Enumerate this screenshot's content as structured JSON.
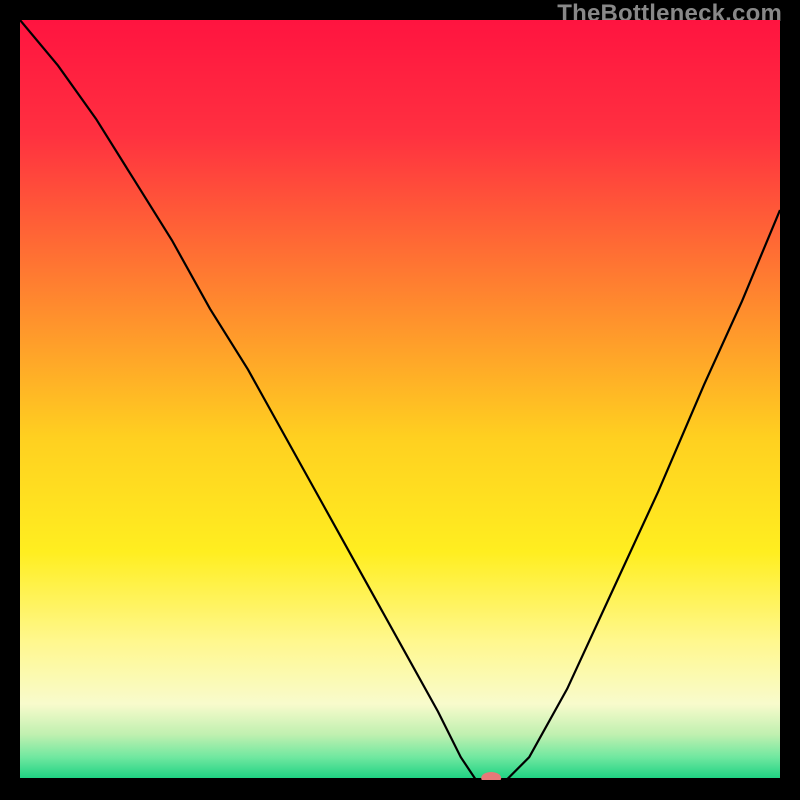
{
  "watermark": "TheBottleneck.com",
  "chart_data": {
    "type": "line",
    "title": "",
    "xlabel": "",
    "ylabel": "",
    "xlim": [
      0,
      100
    ],
    "ylim": [
      0,
      100
    ],
    "background_gradient": {
      "stops": [
        {
          "pos": 0.0,
          "color": "#ff1440"
        },
        {
          "pos": 0.15,
          "color": "#ff3040"
        },
        {
          "pos": 0.35,
          "color": "#ff8030"
        },
        {
          "pos": 0.55,
          "color": "#ffd020"
        },
        {
          "pos": 0.7,
          "color": "#ffee20"
        },
        {
          "pos": 0.82,
          "color": "#fff890"
        },
        {
          "pos": 0.9,
          "color": "#f8fbcc"
        },
        {
          "pos": 0.94,
          "color": "#c0f0b0"
        },
        {
          "pos": 0.97,
          "color": "#70e8a0"
        },
        {
          "pos": 1.0,
          "color": "#18d080"
        }
      ]
    },
    "series": [
      {
        "name": "bottleneck-curve",
        "color": "#000000",
        "x": [
          0,
          5,
          10,
          15,
          20,
          25,
          30,
          35,
          40,
          45,
          50,
          55,
          58,
          60,
          62,
          64,
          67,
          72,
          78,
          84,
          90,
          95,
          100
        ],
        "y": [
          100,
          94,
          87,
          79,
          71,
          62,
          54,
          45,
          36,
          27,
          18,
          9,
          3,
          0,
          0,
          0,
          3,
          12,
          25,
          38,
          52,
          63,
          75
        ]
      }
    ],
    "marker": {
      "name": "optimal-point",
      "x": 62,
      "y": 0,
      "color": "#e77878",
      "rx": 10,
      "ry": 6
    }
  }
}
